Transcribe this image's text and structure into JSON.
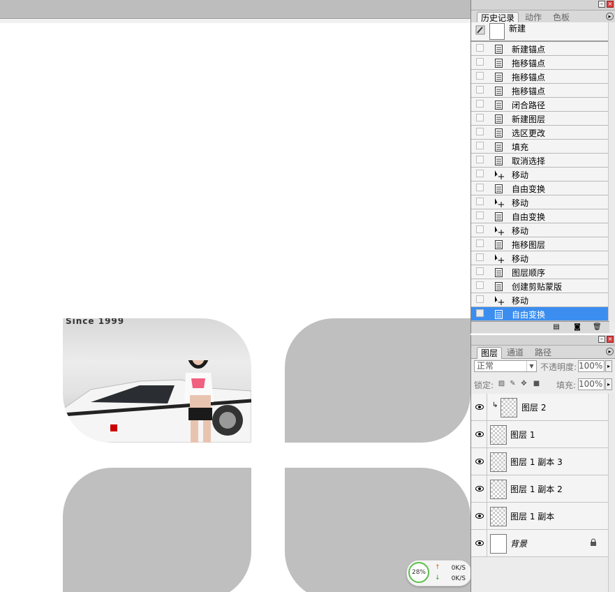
{
  "history_panel": {
    "tabs": [
      "历史记录",
      "动作",
      "色板"
    ],
    "snapshot_label": "新建",
    "items": [
      {
        "label": "新建锚点",
        "icon": "history-state-icon"
      },
      {
        "label": "拖移锚点",
        "icon": "history-state-icon"
      },
      {
        "label": "拖移锚点",
        "icon": "history-state-icon"
      },
      {
        "label": "拖移锚点",
        "icon": "history-state-icon"
      },
      {
        "label": "闭合路径",
        "icon": "history-state-icon"
      },
      {
        "label": "新建图层",
        "icon": "history-state-icon"
      },
      {
        "label": "选区更改",
        "icon": "history-state-icon"
      },
      {
        "label": "填充",
        "icon": "fill-icon"
      },
      {
        "label": "取消选择",
        "icon": "history-state-icon"
      },
      {
        "label": "移动",
        "icon": "move-tool-icon"
      },
      {
        "label": "自由变换",
        "icon": "history-state-icon"
      },
      {
        "label": "移动",
        "icon": "move-tool-icon"
      },
      {
        "label": "自由变换",
        "icon": "history-state-icon"
      },
      {
        "label": "移动",
        "icon": "move-tool-icon"
      },
      {
        "label": "拖移图层",
        "icon": "history-state-icon"
      },
      {
        "label": "移动",
        "icon": "move-tool-icon"
      },
      {
        "label": "图层顺序",
        "icon": "history-state-icon"
      },
      {
        "label": "创建剪贴蒙版",
        "icon": "history-state-icon"
      },
      {
        "label": "移动",
        "icon": "move-tool-icon"
      },
      {
        "label": "自由变换",
        "icon": "history-state-icon",
        "selected": true
      }
    ]
  },
  "layers_panel": {
    "tabs": [
      "图层",
      "通道",
      "路径"
    ],
    "blend_mode": "正常",
    "opacity_label": "不透明度:",
    "opacity_value": "100%",
    "lock_label": "锁定:",
    "fill_label": "填充:",
    "fill_value": "100%",
    "layers": [
      {
        "name": "图层 2",
        "clipped": true,
        "visible": true
      },
      {
        "name": "图层 1",
        "visible": true
      },
      {
        "name": "图层 1 副本 3",
        "visible": true
      },
      {
        "name": "图层 1 副本 2",
        "visible": true
      },
      {
        "name": "图层 1 副本",
        "visible": true
      },
      {
        "name": "背景",
        "visible": true,
        "locked": true
      }
    ]
  },
  "canvas": {
    "photo_text": "Since 1999",
    "shape_color": "#bfbfbf"
  },
  "network_widget": {
    "percent": "28%",
    "upload": "0K/S",
    "download": "0K/S"
  },
  "colors": {
    "selection": "#3b8ef0",
    "panel_bg": "#ececec"
  }
}
